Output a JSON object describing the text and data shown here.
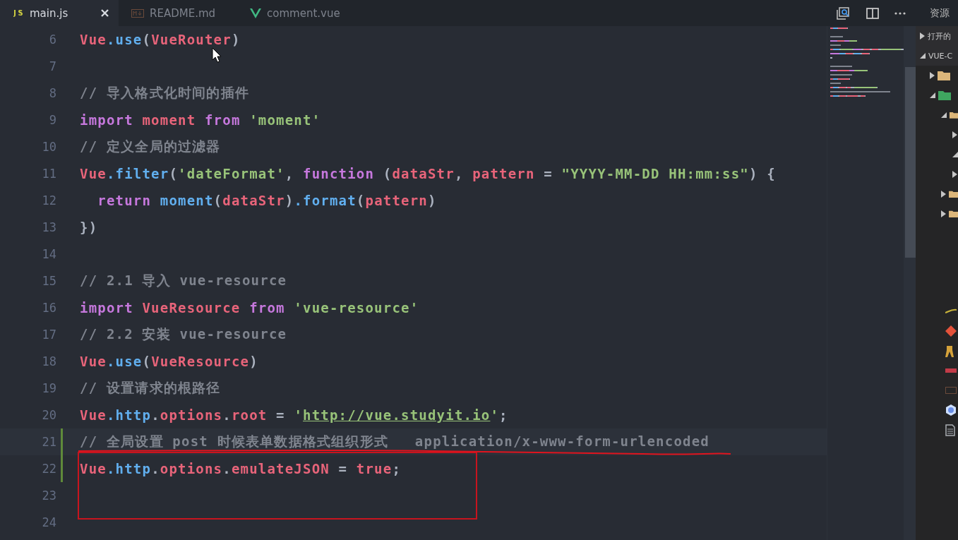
{
  "tabs": [
    {
      "label": "main.js",
      "kind": "js",
      "selected": true,
      "closable": true
    },
    {
      "label": "README.md",
      "kind": "md",
      "selected": false,
      "closable": false
    },
    {
      "label": "comment.vue",
      "kind": "vue",
      "selected": false,
      "closable": false
    }
  ],
  "sidebar": {
    "title": "资源",
    "sections": [
      {
        "label": "打开的",
        "expanded": false
      },
      {
        "label": "VUE-C",
        "expanded": true
      }
    ],
    "tree": [
      {
        "kind": "folder",
        "expanded": false
      },
      {
        "kind": "vue-folder",
        "expanded": true,
        "children": [
          {
            "kind": "folder",
            "expanded": true,
            "children": [
              {
                "expanded": false
              },
              {
                "expanded": true
              },
              {
                "expanded": false
              }
            ]
          },
          {
            "kind": "folder",
            "expanded": false
          },
          {
            "kind": "folder",
            "expanded": false
          }
        ]
      }
    ],
    "files": [
      {
        "kind": "babel"
      },
      {
        "kind": "git"
      },
      {
        "kind": "figure"
      },
      {
        "kind": "npm"
      },
      {
        "kind": "md"
      },
      {
        "kind": "hexagon"
      },
      {
        "kind": "document"
      }
    ]
  },
  "editor": {
    "lines": [
      {
        "number": "6",
        "current": false,
        "modified": false,
        "tokens": [
          {
            "kind": "var",
            "text": "Vue"
          },
          {
            "kind": "prop",
            "text": ".use"
          },
          {
            "kind": "plain",
            "text": "("
          },
          {
            "kind": "var",
            "text": "VueRouter"
          },
          {
            "kind": "plain",
            "text": ")"
          }
        ]
      },
      {
        "number": "7",
        "current": false,
        "modified": false
      },
      {
        "number": "8",
        "current": false,
        "modified": false,
        "tokens": [
          {
            "kind": "comment",
            "text": "// 导入格式化时间的插件"
          }
        ]
      },
      {
        "number": "9",
        "current": false,
        "modified": false,
        "tokens": [
          {
            "kind": "kw",
            "text": "import "
          },
          {
            "kind": "var",
            "text": "moment "
          },
          {
            "kind": "kw",
            "text": "from "
          },
          {
            "kind": "str",
            "text": "'moment'"
          }
        ]
      },
      {
        "number": "10",
        "current": false,
        "modified": false,
        "tokens": [
          {
            "kind": "comment",
            "text": "// 定义全局的过滤器"
          }
        ]
      },
      {
        "number": "11",
        "current": false,
        "modified": false,
        "tokens": [
          {
            "kind": "var",
            "text": "Vue"
          },
          {
            "kind": "prop",
            "text": ".filter"
          },
          {
            "kind": "plain",
            "text": "("
          },
          {
            "kind": "str",
            "text": "'dateFormat'"
          },
          {
            "kind": "plain",
            "text": ", "
          },
          {
            "kind": "kw",
            "text": "function"
          },
          {
            "kind": "plain",
            "text": " ("
          },
          {
            "kind": "var",
            "text": "dataStr"
          },
          {
            "kind": "plain",
            "text": ", "
          },
          {
            "kind": "var",
            "text": "pattern"
          },
          {
            "kind": "plain",
            "text": " = "
          },
          {
            "kind": "str",
            "text": "\"YYYY-MM-DD HH:mm:ss\""
          },
          {
            "kind": "plain",
            "text": ") {"
          }
        ]
      },
      {
        "number": "12",
        "current": false,
        "modified": false,
        "tokens": [
          {
            "kind": "kw",
            "text": "  return "
          },
          {
            "kind": "prop",
            "text": "moment"
          },
          {
            "kind": "plain",
            "text": "("
          },
          {
            "kind": "var",
            "text": "dataStr"
          },
          {
            "kind": "plain",
            "text": ")"
          },
          {
            "kind": "prop",
            "text": ".format"
          },
          {
            "kind": "plain",
            "text": "("
          },
          {
            "kind": "var",
            "text": "pattern"
          },
          {
            "kind": "plain",
            "text": ")"
          }
        ]
      },
      {
        "number": "13",
        "current": false,
        "modified": false,
        "tokens": [
          {
            "kind": "plain",
            "text": "})"
          }
        ]
      },
      {
        "number": "14",
        "current": false,
        "modified": false
      },
      {
        "number": "15",
        "current": false,
        "modified": false,
        "tokens": [
          {
            "kind": "comment",
            "text": "// 2.1 导入 vue-resource"
          }
        ]
      },
      {
        "number": "16",
        "current": false,
        "modified": false,
        "tokens": [
          {
            "kind": "kw",
            "text": "import "
          },
          {
            "kind": "var",
            "text": "VueResource "
          },
          {
            "kind": "kw",
            "text": "from "
          },
          {
            "kind": "str",
            "text": "'vue-resource'"
          }
        ]
      },
      {
        "number": "17",
        "current": false,
        "modified": false,
        "tokens": [
          {
            "kind": "comment",
            "text": "// 2.2 安装 vue-resource"
          }
        ]
      },
      {
        "number": "18",
        "current": false,
        "modified": false,
        "tokens": [
          {
            "kind": "var",
            "text": "Vue"
          },
          {
            "kind": "prop",
            "text": ".use"
          },
          {
            "kind": "plain",
            "text": "("
          },
          {
            "kind": "var",
            "text": "VueResource"
          },
          {
            "kind": "plain",
            "text": ")"
          }
        ]
      },
      {
        "number": "19",
        "current": false,
        "modified": false,
        "tokens": [
          {
            "kind": "comment",
            "text": "// 设置请求的根路径"
          }
        ]
      },
      {
        "number": "20",
        "current": false,
        "modified": false,
        "tokens": [
          {
            "kind": "var",
            "text": "Vue"
          },
          {
            "kind": "prop",
            "text": ".http"
          },
          {
            "kind": "plain",
            "text": "."
          },
          {
            "kind": "var",
            "text": "options"
          },
          {
            "kind": "plain",
            "text": "."
          },
          {
            "kind": "var",
            "text": "root"
          },
          {
            "kind": "plain",
            "text": " = "
          },
          {
            "kind": "str",
            "text": "'"
          },
          {
            "kind": "url",
            "text": "http://vue.studyit.io"
          },
          {
            "kind": "str",
            "text": "'"
          },
          {
            "kind": "plain",
            "text": ";"
          }
        ]
      },
      {
        "number": "21",
        "current": true,
        "modified": true,
        "tokens": [
          {
            "kind": "comment",
            "text": "// 全局设置 post 时候表单数据格式组织形式   application/x-www-form-urlencoded"
          }
        ]
      },
      {
        "number": "22",
        "current": false,
        "modified": true,
        "tokens": [
          {
            "kind": "var",
            "text": "Vue"
          },
          {
            "kind": "prop",
            "text": ".http"
          },
          {
            "kind": "plain",
            "text": "."
          },
          {
            "kind": "var",
            "text": "options"
          },
          {
            "kind": "plain",
            "text": "."
          },
          {
            "kind": "var",
            "text": "emulateJSON"
          },
          {
            "kind": "plain",
            "text": " = "
          },
          {
            "kind": "const",
            "text": "true"
          },
          {
            "kind": "plain",
            "text": ";"
          }
        ]
      },
      {
        "number": "23",
        "current": false,
        "modified": false
      },
      {
        "number": "24",
        "current": false,
        "modified": false
      }
    ]
  }
}
